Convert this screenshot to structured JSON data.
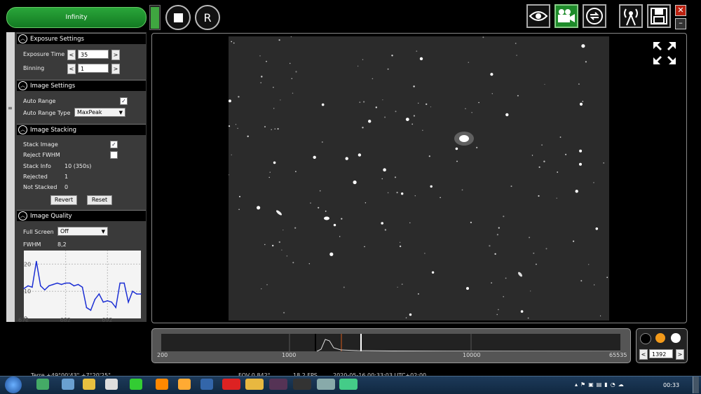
{
  "toolbar": {
    "infinity_label": "Infinity",
    "stop_label": "",
    "record_label": "R",
    "close_label": "✕",
    "min_label": "–",
    "level_percent": 90
  },
  "exposure": {
    "title": "Exposure Settings",
    "time_label": "Exposure Time",
    "time_value": "35",
    "binning_label": "Binning",
    "binning_value": "1",
    "prev": "<",
    "next": ">"
  },
  "image_settings": {
    "title": "Image Settings",
    "auto_range_label": "Auto Range",
    "auto_range_checked": "✓",
    "auto_range_type_label": "Auto Range Type",
    "auto_range_type_value": "MaxPeak"
  },
  "stacking": {
    "title": "Image Stacking",
    "stack_image_label": "Stack Image",
    "stack_image_checked": "✓",
    "reject_fwhm_label": "Reject FWHM",
    "stack_info_label": "Stack Info",
    "stack_info_value": "10 (350s)",
    "rejected_label": "Rejected",
    "rejected_value": "1",
    "not_stacked_label": "Not Stacked",
    "not_stacked_value": "0",
    "revert_label": "Revert",
    "reset_label": "Reset"
  },
  "quality": {
    "title": "Image Quality",
    "full_screen_label": "Full Screen",
    "full_screen_value": "Off",
    "fwhm_label": "FWHM",
    "fwhm_value": "8,2",
    "y_ticks": [
      "20",
      "10",
      "0"
    ],
    "x_ticks": [
      "672",
      "682",
      "692"
    ]
  },
  "chart_data": {
    "type": "line",
    "title": "",
    "xlabel": "",
    "ylabel": "",
    "x_range": [
      672,
      700
    ],
    "ylim": [
      0,
      25
    ],
    "series": [
      {
        "color": "#1c2fd4",
        "x": [
          672,
          673,
          674,
          675,
          676,
          677,
          678,
          679,
          680,
          681,
          682,
          683,
          684,
          685,
          686,
          687,
          688,
          689,
          690,
          691,
          692,
          693,
          694,
          695,
          696,
          697,
          698,
          699,
          700
        ],
        "values": [
          11,
          12,
          11.5,
          21,
          12,
          10.5,
          12,
          12.5,
          13,
          12.5,
          13,
          13,
          12,
          12.5,
          11.5,
          4,
          3,
          7,
          9,
          6,
          6.5,
          6,
          4,
          13,
          13,
          6,
          10,
          9,
          9
        ]
      }
    ]
  },
  "histogram": {
    "ticks": [
      "200",
      "1000",
      "10000",
      "65535"
    ]
  },
  "color_ctrl": {
    "value": "1392",
    "prev": "<",
    "next": ">",
    "dot_colors": [
      "#000000",
      "#f39a1a",
      "#ffffff"
    ]
  },
  "status": {
    "location": "Terre  +49°00'43\"  +7°20'25\"",
    "fov": "FOV 0.842°",
    "fps": "18.2 FPS",
    "timestamp": "2020-05-16 00:33:03 UTC+02:00"
  },
  "taskbar": {
    "clock": "00:33"
  }
}
